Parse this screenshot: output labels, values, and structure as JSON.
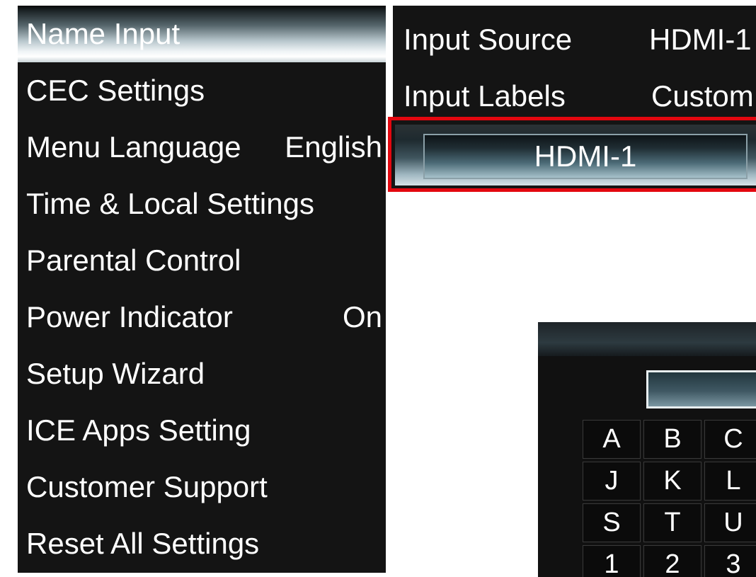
{
  "menu": {
    "items": [
      {
        "label": "Name Input",
        "value": "",
        "selected": true
      },
      {
        "label": "CEC Settings",
        "value": ""
      },
      {
        "label": "Menu Language",
        "value": "English"
      },
      {
        "label": "Time & Local Settings",
        "value": ""
      },
      {
        "label": "Parental Control",
        "value": ""
      },
      {
        "label": "Power Indicator",
        "value": "On"
      },
      {
        "label": "Setup Wizard",
        "value": ""
      },
      {
        "label": "ICE Apps Setting",
        "value": ""
      },
      {
        "label": "Customer Support",
        "value": ""
      },
      {
        "label": "Reset All Settings",
        "value": ""
      }
    ]
  },
  "panel": {
    "input_source_label": "Input Source",
    "input_source_value": "HDMI-1",
    "input_labels_label": "Input Labels",
    "input_labels_value": "Custom",
    "name_field_value": "HDMI-1",
    "highlight_color": "#e3070f"
  },
  "keyboard": {
    "input_value": "",
    "rows": [
      [
        "A",
        "B",
        "C"
      ],
      [
        "J",
        "K",
        "L"
      ],
      [
        "S",
        "T",
        "U"
      ],
      [
        "1",
        "2",
        "3"
      ]
    ]
  }
}
